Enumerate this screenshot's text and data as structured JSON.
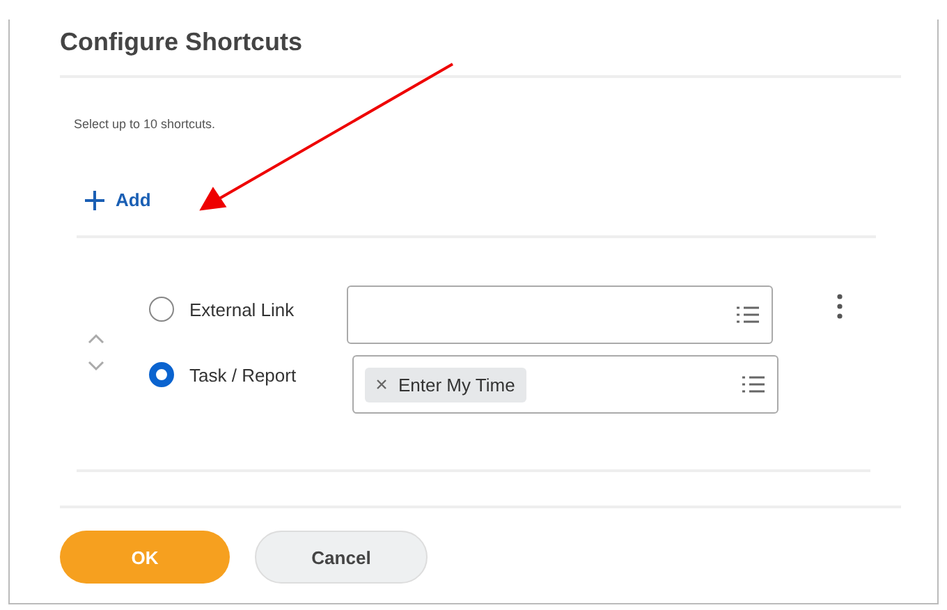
{
  "dialog": {
    "title": "Configure Shortcuts",
    "hint": "Select up to 10 shortcuts.",
    "add_label": "Add"
  },
  "shortcut": {
    "options": [
      {
        "label": "External Link",
        "selected": false
      },
      {
        "label": "Task / Report",
        "selected": true,
        "tags": [
          "Enter My Time"
        ]
      }
    ]
  },
  "buttons": [
    {
      "label": "OK",
      "kind": "primary"
    },
    {
      "label": "Cancel",
      "kind": "secondary"
    }
  ]
}
